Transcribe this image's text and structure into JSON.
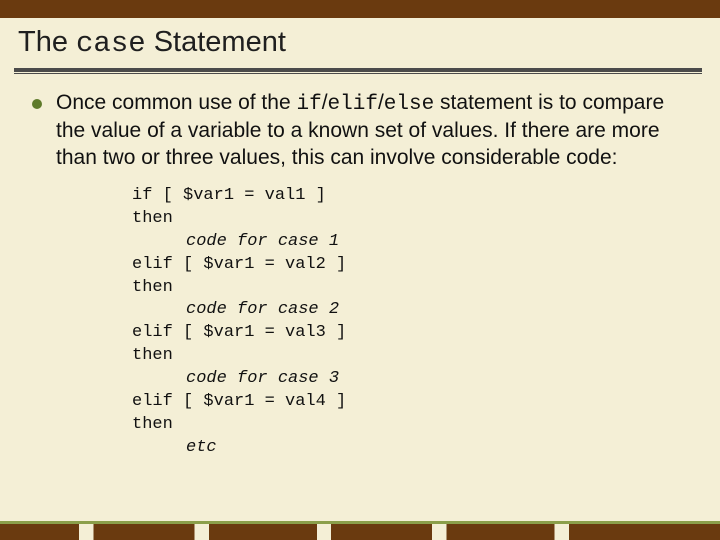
{
  "title": {
    "part1": "The ",
    "code": "case",
    "part2": " Statement"
  },
  "bullet": {
    "p1": "Once common use of the ",
    "c1": "if",
    "s1": "/",
    "c2": "elif",
    "s2": "/",
    "c3": "else",
    "p2": " statement is to compare the value of a variable to a known set of values.  If there are more than two or three values, this can involve considerable code:"
  },
  "code": {
    "l01": "if [ $var1 = val1 ]",
    "l02": "then",
    "l03": "code for case 1",
    "l04": "elif [ $var1 = val2 ]",
    "l05": "then",
    "l06": "code for case 2",
    "l07": "elif [ $var1 = val3 ]",
    "l08": "then",
    "l09": "code for case 3",
    "l10": "elif [ $var1 = val4 ]",
    "l11": "then",
    "l12": "etc"
  }
}
